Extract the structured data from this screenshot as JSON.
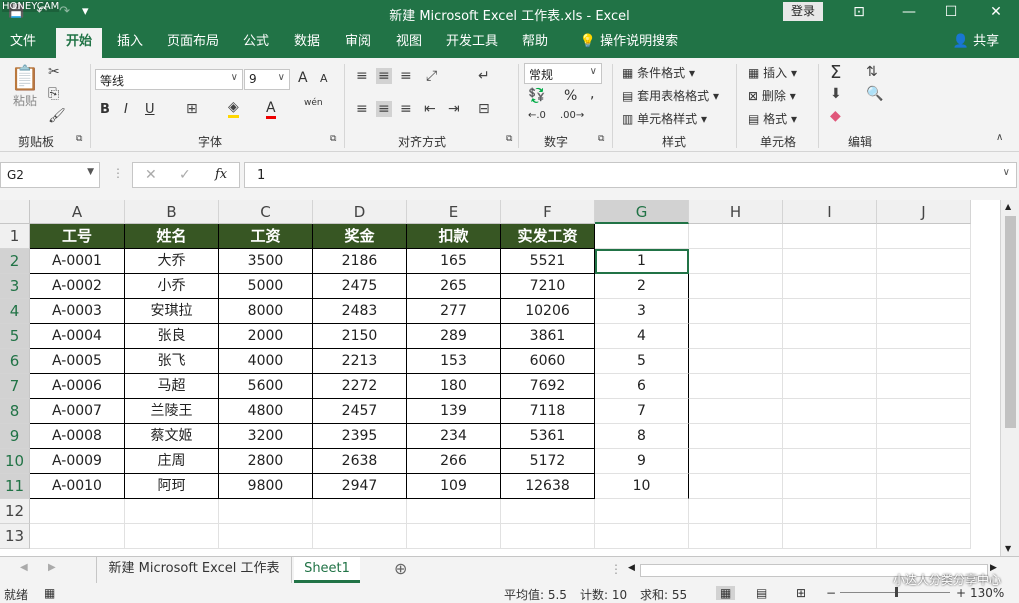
{
  "watermark_top": "HONEYCAM",
  "watermark_bottom": "小达人分类分享中心",
  "titlebar": {
    "title": "新建 Microsoft Excel 工作表.xls  -  Excel",
    "login": "登录",
    "qat_save": "💾",
    "qat_undo": "↶",
    "qat_redo": "↷",
    "qat_more": "▾",
    "win_ribbon": "⊡",
    "win_min": "—",
    "win_max": "☐",
    "win_close": "✕"
  },
  "tabs": [
    "文件",
    "开始",
    "插入",
    "页面布局",
    "公式",
    "数据",
    "审阅",
    "视图",
    "开发工具",
    "帮助"
  ],
  "tell_me": "操作说明搜索",
  "share": "共享",
  "ribbon": {
    "clipboard": {
      "label": "剪贴板",
      "paste": "粘贴"
    },
    "font": {
      "label": "字体",
      "name": "等线",
      "size": "9",
      "bold": "B",
      "italic": "I",
      "underline": "U",
      "grow": "A",
      "shrink": "A",
      "color_a": "A",
      "wen": "wén"
    },
    "alignment": {
      "label": "对齐方式"
    },
    "number": {
      "label": "数字",
      "format": "常规",
      "percent": "%",
      "comma": ","
    },
    "styles": {
      "label": "样式",
      "conditional": "条件格式",
      "table_format": "套用表格格式",
      "cell_style": "单元格样式"
    },
    "cells": {
      "label": "单元格",
      "insert": "插入",
      "delete": "删除",
      "format": "格式"
    },
    "editing": {
      "label": "编辑",
      "sum": "Σ"
    }
  },
  "formula_bar": {
    "name_box": "G2",
    "fx": "fx",
    "value": "1"
  },
  "columns": [
    "A",
    "B",
    "C",
    "D",
    "E",
    "F",
    "G",
    "H",
    "I",
    "J"
  ],
  "rows": [
    "1",
    "2",
    "3",
    "4",
    "5",
    "6",
    "7",
    "8",
    "9",
    "10",
    "11",
    "12",
    "13"
  ],
  "table": {
    "headers": [
      "工号",
      "姓名",
      "工资",
      "奖金",
      "扣款",
      "实发工资"
    ],
    "rows": [
      [
        "A-0001",
        "大乔",
        "3500",
        "2186",
        "165",
        "5521"
      ],
      [
        "A-0002",
        "小乔",
        "5000",
        "2475",
        "265",
        "7210"
      ],
      [
        "A-0003",
        "安琪拉",
        "8000",
        "2483",
        "277",
        "10206"
      ],
      [
        "A-0004",
        "张良",
        "2000",
        "2150",
        "289",
        "3861"
      ],
      [
        "A-0005",
        "张飞",
        "4000",
        "2213",
        "153",
        "6060"
      ],
      [
        "A-0006",
        "马超",
        "5600",
        "2272",
        "180",
        "7692"
      ],
      [
        "A-0007",
        "兰陵王",
        "4800",
        "2457",
        "139",
        "7118"
      ],
      [
        "A-0008",
        "蔡文姬",
        "3200",
        "2395",
        "234",
        "5361"
      ],
      [
        "A-0009",
        "庄周",
        "2800",
        "2638",
        "266",
        "5172"
      ],
      [
        "A-0010",
        "阿珂",
        "9800",
        "2947",
        "109",
        "12638"
      ]
    ]
  },
  "g_column": [
    "1",
    "2",
    "3",
    "4",
    "5",
    "6",
    "7",
    "8",
    "9",
    "10"
  ],
  "sheets": [
    "新建 Microsoft Excel 工作表",
    "Sheet1"
  ],
  "add_sheet": "⊕",
  "status": {
    "ready": "就绪",
    "average": "平均值: 5.5",
    "count": "计数: 10",
    "sum": "求和: 55",
    "zoom": "130%",
    "zoom_minus": "−",
    "zoom_plus": "+"
  },
  "colors": {
    "excel_green": "#217346",
    "header_fill": "#375623"
  }
}
